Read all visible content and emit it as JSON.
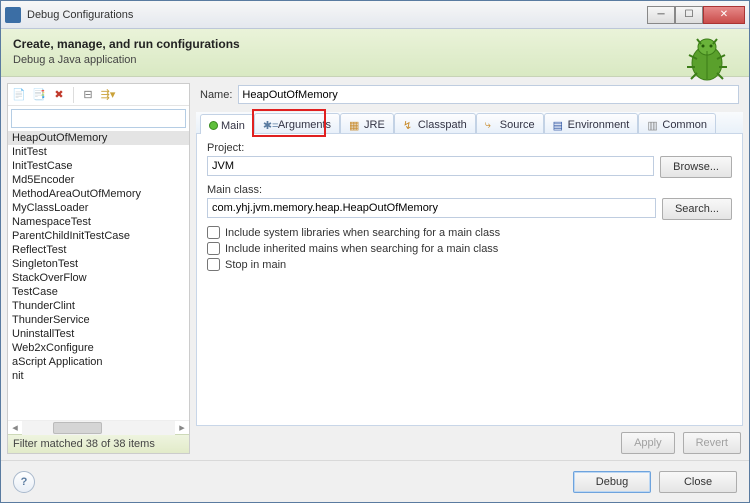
{
  "window": {
    "title": "Debug Configurations"
  },
  "header": {
    "title": "Create, manage, and run configurations",
    "subtitle": "Debug a Java application"
  },
  "filter_input": "",
  "tree_items": [
    "HeapOutOfMemory",
    "InitTest",
    "InitTestCase",
    "Md5Encoder",
    "MethodAreaOutOfMemory",
    "MyClassLoader",
    "NamespaceTest",
    "ParentChildInitTestCase",
    "ReflectTest",
    "SingletonTest",
    "StackOverFlow",
    "TestCase",
    "ThunderClint",
    "ThunderService",
    "UninstallTest",
    "Web2xConfigure",
    "aScript Application",
    "nit"
  ],
  "tree_selected_index": 0,
  "filter_status": "Filter matched 38 of 38 items",
  "name_label": "Name:",
  "name_value": "HeapOutOfMemory",
  "tabs": {
    "main": "Main",
    "arguments": "Arguments",
    "jre": "JRE",
    "classpath": "Classpath",
    "source": "Source",
    "environment": "Environment",
    "common": "Common"
  },
  "formMain": {
    "project_label": "Project:",
    "project_value": "JVM",
    "browse": "Browse...",
    "mainclass_label": "Main class:",
    "mainclass_value": "com.yhj.jvm.memory.heap.HeapOutOfMemory",
    "search": "Search...",
    "chk1": "Include system libraries when searching for a main class",
    "chk2": "Include inherited mains when searching for a main class",
    "chk3": "Stop in main"
  },
  "buttons": {
    "apply": "Apply",
    "revert": "Revert",
    "debug": "Debug",
    "close": "Close"
  }
}
